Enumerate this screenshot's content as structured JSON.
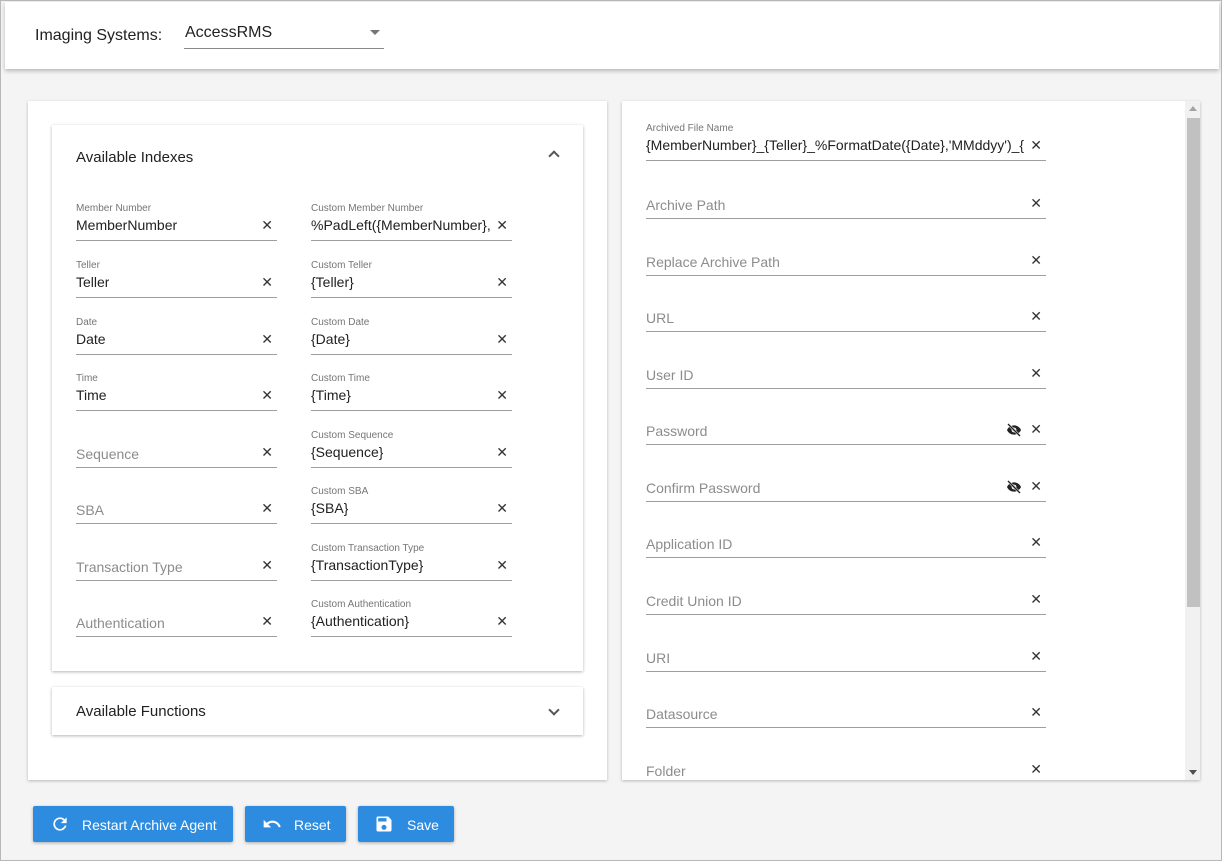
{
  "header": {
    "imaging_label": "Imaging Systems:",
    "imaging_value": "AccessRMS"
  },
  "indexes": {
    "title": "Available Indexes",
    "fields": [
      {
        "label": "Member Number",
        "value": "MemberNumber",
        "custom_label": "Custom Member Number",
        "custom_value": "%PadLeft({MemberNumber},"
      },
      {
        "label": "Teller",
        "value": "Teller",
        "custom_label": "Custom Teller",
        "custom_value": "{Teller}"
      },
      {
        "label": "Date",
        "value": "Date",
        "custom_label": "Custom Date",
        "custom_value": "{Date}"
      },
      {
        "label": "Time",
        "value": "Time",
        "custom_label": "Custom Time",
        "custom_value": "{Time}"
      },
      {
        "placeholder": "Sequence",
        "custom_label": "Custom Sequence",
        "custom_value": "{Sequence}"
      },
      {
        "placeholder": "SBA",
        "custom_label": "Custom SBA",
        "custom_value": "{SBA}"
      },
      {
        "placeholder": "Transaction Type",
        "custom_label": "Custom Transaction Type",
        "custom_value": "{TransactionType}"
      },
      {
        "placeholder": "Authentication",
        "custom_label": "Custom Authentication",
        "custom_value": "{Authentication}"
      }
    ]
  },
  "functions": {
    "title": "Available Functions"
  },
  "settings": {
    "archived_file_name_label": "Archived File Name",
    "archived_file_name_value": "{MemberNumber}_{Teller}_%FormatDate({Date},'MMddyy')_{",
    "archive_path": "Archive Path",
    "replace_archive_path": "Replace Archive Path",
    "url": "URL",
    "user_id": "User ID",
    "password": "Password",
    "confirm_password": "Confirm Password",
    "application_id": "Application ID",
    "credit_union_id": "Credit Union ID",
    "uri": "URI",
    "datasource": "Datasource",
    "folder": "Folder"
  },
  "actions": {
    "restart": "Restart Archive Agent",
    "reset": "Reset",
    "save": "Save"
  },
  "colors": {
    "primary": "#2e8ce0"
  }
}
